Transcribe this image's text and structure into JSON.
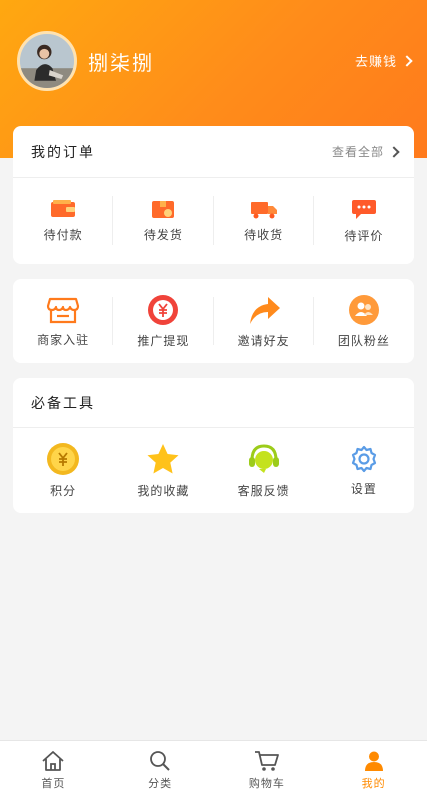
{
  "profile": {
    "username": "捌柒捌",
    "earn_label": "去赚钱"
  },
  "orders": {
    "title": "我的订单",
    "view_all": "查看全部",
    "items": [
      {
        "label": "待付款",
        "icon": "wallet-icon"
      },
      {
        "label": "待发货",
        "icon": "box-icon"
      },
      {
        "label": "待收货",
        "icon": "truck-icon"
      },
      {
        "label": "待评价",
        "icon": "comment-icon"
      }
    ]
  },
  "services": {
    "items": [
      {
        "label": "商家入驻",
        "icon": "store-icon"
      },
      {
        "label": "推广提现",
        "icon": "yuan-icon"
      },
      {
        "label": "邀请好友",
        "icon": "share-arrow-icon"
      },
      {
        "label": "团队粉丝",
        "icon": "team-icon"
      }
    ]
  },
  "tools": {
    "title": "必备工具",
    "items": [
      {
        "label": "积分",
        "icon": "coin-icon"
      },
      {
        "label": "我的收藏",
        "icon": "star-icon"
      },
      {
        "label": "客服反馈",
        "icon": "headset-icon"
      },
      {
        "label": "设置",
        "icon": "gear-icon"
      }
    ]
  },
  "tabbar": {
    "items": [
      {
        "label": "首页",
        "icon": "home-icon"
      },
      {
        "label": "分类",
        "icon": "search-icon"
      },
      {
        "label": "购物车",
        "icon": "cart-icon"
      },
      {
        "label": "我的",
        "icon": "user-icon"
      }
    ],
    "active_index": 3
  },
  "colors": {
    "accent": "#ff8a00",
    "header_start": "#ffa810",
    "header_end": "#ff7a1c"
  }
}
